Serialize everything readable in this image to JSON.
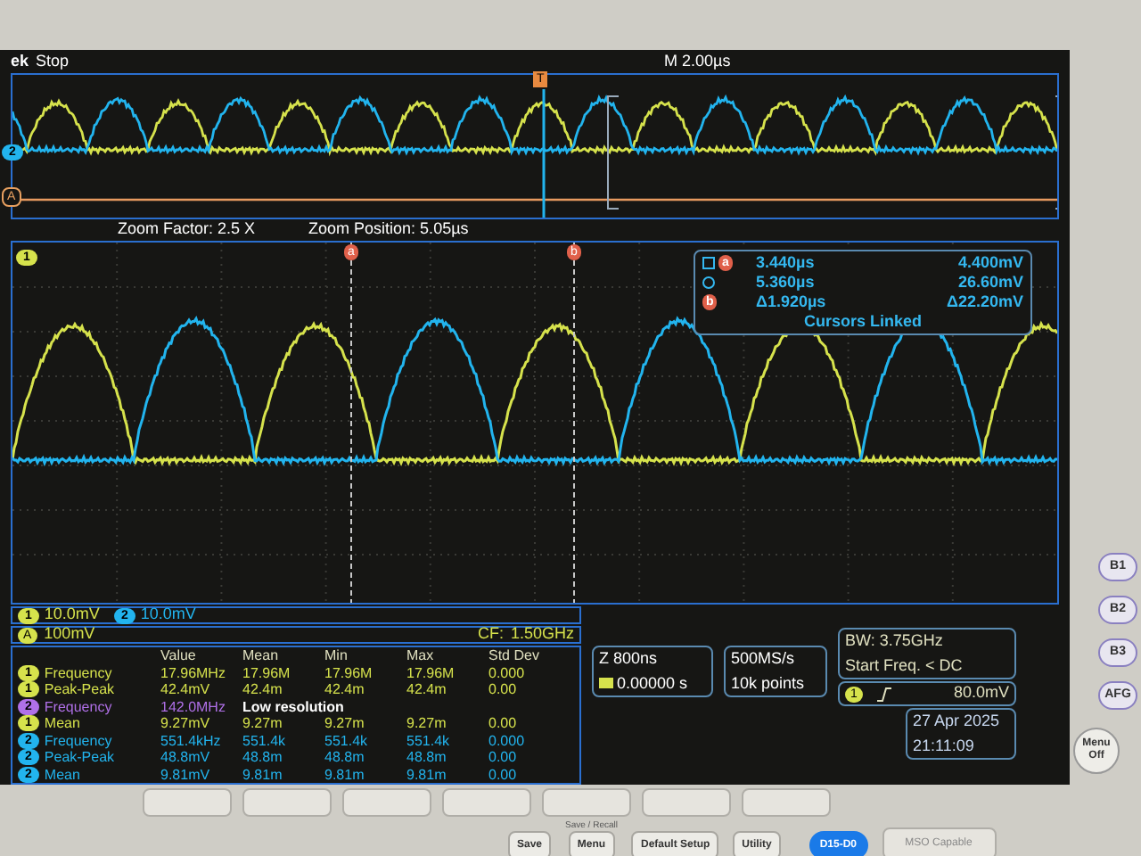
{
  "status": {
    "brand": "ek",
    "state": "Stop",
    "timebase": "M 2.00µs"
  },
  "overview": {
    "trigger_marker": "T",
    "channel_marker": "2",
    "math_marker": "A"
  },
  "zoom": {
    "factor": "Zoom Factor: 2.5 X",
    "position": "Zoom Position: 5.05µs",
    "channel_marker": "1",
    "cursor_labels": [
      "a",
      "b"
    ]
  },
  "cursor_readout": {
    "rows": [
      {
        "marker": "a",
        "time": "3.440µs",
        "volts": "4.400mV"
      },
      {
        "marker": "",
        "time": "5.360µs",
        "volts": "26.60mV"
      },
      {
        "marker": "b",
        "time": "Δ1.920µs",
        "volts": "Δ22.20mV"
      }
    ],
    "note": "Cursors Linked"
  },
  "channels": [
    {
      "badge": "1",
      "scale": "10.0mV",
      "color": "#d6e24c"
    },
    {
      "badge": "2",
      "scale": "10.0mV",
      "color": "#22b4ee"
    }
  ],
  "math": {
    "badge": "A",
    "scale": "100mV",
    "cf_label": "CF:",
    "cf_value": "1.50GHz"
  },
  "measurements": {
    "columns": [
      "Value",
      "Mean",
      "Min",
      "Max",
      "Std Dev"
    ],
    "rows": [
      {
        "badge": "1",
        "name": "Frequency",
        "color": "#d6e24c",
        "cells": [
          "17.96MHz",
          "17.96M",
          "17.96M",
          "17.96M",
          "0.000"
        ]
      },
      {
        "badge": "1",
        "name": "Peak-Peak",
        "color": "#d6e24c",
        "cells": [
          "42.4mV",
          "42.4m",
          "42.4m",
          "42.4m",
          "0.00"
        ]
      },
      {
        "badge": "2",
        "name": "Frequency",
        "color": "#b070e8",
        "cells": [
          "142.0MHz",
          "Low resolution"
        ]
      },
      {
        "badge": "1",
        "name": "Mean",
        "color": "#d6e24c",
        "cells": [
          "9.27mV",
          "9.27m",
          "9.27m",
          "9.27m",
          "0.00"
        ]
      },
      {
        "badge": "2",
        "name": "Frequency",
        "color": "#22b4ee",
        "cells": [
          "551.4kHz",
          "551.4k",
          "551.4k",
          "551.4k",
          "0.000"
        ]
      },
      {
        "badge": "2",
        "name": "Peak-Peak",
        "color": "#22b4ee",
        "cells": [
          "48.8mV",
          "48.8m",
          "48.8m",
          "48.8m",
          "0.00"
        ]
      },
      {
        "badge": "2",
        "name": "Mean",
        "color": "#22b4ee",
        "cells": [
          "9.81mV",
          "9.81m",
          "9.81m",
          "9.81m",
          "0.00"
        ]
      }
    ]
  },
  "horizontal": {
    "scale": "Z 800ns",
    "position": "0.00000 s"
  },
  "acquisition": {
    "rate": "500MS/s",
    "points": "10k points"
  },
  "trigger": {
    "bandwidth": "BW: 3.75GHz",
    "filter": "Start Freq. < DC",
    "source": "1",
    "level": "80.0mV"
  },
  "datetime": {
    "date": "27 Apr 2025",
    "time": "21:11:09"
  },
  "side_buttons": [
    "B1",
    "B2",
    "B3",
    "AFG"
  ],
  "menu_off": "Menu Off",
  "bottom_buttons": [
    {
      "label": "Save",
      "kind": "plain"
    },
    {
      "label": "Menu",
      "kind": "plain",
      "caption": "Save / Recall"
    },
    {
      "label": "Default Setup",
      "kind": "plain"
    },
    {
      "label": "Utility",
      "kind": "plain"
    },
    {
      "label": "D15-D0",
      "kind": "lit"
    },
    {
      "label": "MSO Capable",
      "kind": "wide"
    }
  ]
}
